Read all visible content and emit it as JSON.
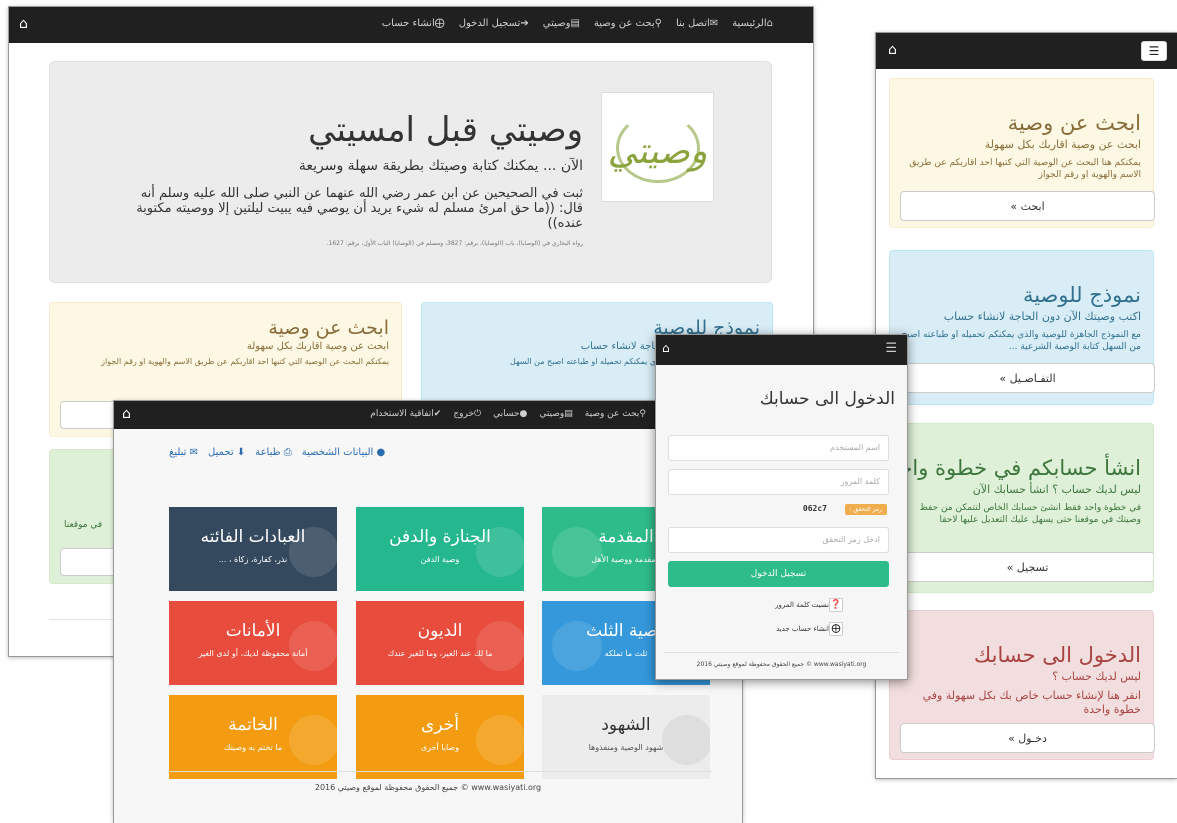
{
  "main": {
    "nav": {
      "items": [
        "الرئيسية",
        "اتصل بنا",
        "بحث عن وصية",
        "وصيتي",
        "تسجيل الدخول",
        "انشاء حساب"
      ]
    },
    "jumbotron": {
      "logo_text": "وصيتي",
      "title": "وصيتي قبل امسيتي",
      "subtitle": "الآن ... يمكنك كتابة وصيتك بطريقة سهلة وسريعة",
      "hadith": "ثبت في الصحيحين عن ابن عمر رضي الله عنهما عن النبي صلى الله عليه وسلم أنه قال: ((ما حق امرئ مسلم له شيء يريد أن يوصي فيه يبيت ليلتين إلا ووصيته مكتوبة عنده))",
      "reference": "رواه البخاري في (الوصايا)، باب (الوصايا)، برقم: 3827، ومسلم في (الوصايا) الباب الأول، برقم: 1627."
    },
    "search_box": {
      "title": "ابحث عن وصية",
      "subtitle": "ابحث عن وصية اقاربك بكل سهولة",
      "desc": "يمكنكم البحث عن الوصية التي كتبها احد اقاربكم عن طريق الاسم والهوية او رقم الجواز"
    },
    "template_box": {
      "title": "نموذج للوصية",
      "subtitle": "اكتب وصيتك الآن دون الحاجة لانشاء حساب",
      "desc": "مع النموذج الجاهزة للوصية والذي يمكنكم تحميله او طباعته اصبح من السهل"
    },
    "green_partial": "في موقعنا"
  },
  "side": {
    "boxes": [
      {
        "title": "ابحث عن وصية",
        "subtitle": "ابحث عن وصية اقاربك بكل سهولة",
        "desc": "يمكنكم هنا البحث عن الوصية التي كتبها احد اقاربكم عن طريق الاسم والهوية او رقم الجواز",
        "button": "ابحث »",
        "bg": "#fcf8e3",
        "border": "#faebcc",
        "color": "#8a6d3b"
      },
      {
        "title": "نموذج للوصية",
        "subtitle": "اكتب وصيتك الآن دون الحاجة لانشاء حساب",
        "desc": "مع النموذج الجاهزة للوصية والذي يمكنكم تحميله او طباعته اصبح من السهل كتابة الوصية الشرعية ...",
        "button": "التفـاصـيل »",
        "bg": "#d9edf7",
        "border": "#bce8f1",
        "color": "#31708f"
      },
      {
        "title": "انشأ حسابكم في خطوة واحدة",
        "subtitle": "ليس لديك حساب ؟ انشأ حسابك الآن",
        "desc": "في خطوة واحد فقط انشئ حسابك الخاص لتتمكن من حفظ وصيتك في موقعنا حتى يسهل عليك التعديل عليها لاحقا",
        "button": "تسجيل »",
        "bg": "#dff0d8",
        "border": "#d6e9c6",
        "color": "#3c763d"
      },
      {
        "title": "الدخول الى حسابك",
        "subtitle": "ليس لديك حساب ؟",
        "desc": "انقر هنا لإنشاء حساب خاص بك بكل سهولة وفي خطوة واحدة",
        "button": "دخـول »",
        "bg": "#f2dede",
        "border": "#ebccd1",
        "color": "#a94442"
      }
    ]
  },
  "dashboard": {
    "nav": [
      "بحث عن وصية",
      "وصيتي",
      "حسابي",
      "خروج",
      "اتفاقية الاستخدام"
    ],
    "actions": [
      "البيانات الشخصية",
      "طباعة",
      "تحميل",
      "تبليغ"
    ],
    "tiles": [
      {
        "title": "المقدمة",
        "sub": "المقدمة ووصية الأهل",
        "color": "#2ebc8a"
      },
      {
        "title": "الجنازة والدفن",
        "sub": "وصية الدفن",
        "color": "#25b88f"
      },
      {
        "title": "العبادات الفائته",
        "sub": "نذر، كفارة، زكاة ، ...",
        "color": "#34495e"
      },
      {
        "title": "وصية الثلث",
        "sub": "ثلث ما تملكه",
        "color": "#3498db"
      },
      {
        "title": "الديون",
        "sub": "ما لك عند الغير، وما للغير عندك",
        "color": "#e74c3c"
      },
      {
        "title": "الأمانات",
        "sub": "أمانة محفوظة لديك، أو لدى الغير",
        "color": "#e74c3c"
      },
      {
        "title": "الشهود",
        "sub": "شهود الوصية ومنفذوها",
        "color": "#ececec"
      },
      {
        "title": "أخرى",
        "sub": "وصايا أخرى",
        "color": "#f39c12"
      },
      {
        "title": "الخاتمة",
        "sub": "ما تختم به وصيتك",
        "color": "#f39c12"
      }
    ],
    "footer": "جميع الحقوق محفوظة لموقع وصيتي 2016 © www.wasiyati.org"
  },
  "login": {
    "title": "الدخول الى حسابك",
    "username_placeholder": "اسم المستخدم",
    "password_placeholder": "كلمة المرور",
    "captcha_label": "رمز التحقق :",
    "captcha_code": "062c7",
    "captcha_placeholder": "ادخل رمز التحقق",
    "submit": "تسجيل الدخول",
    "forgot": "نسيت كلمة المرور",
    "create": "انشاء حساب جديد",
    "footer": "جميع الحقوق محفوظة لموقع وصيتي 2016 © www.wasiyati.org",
    "accent": "#2ebc8a"
  }
}
